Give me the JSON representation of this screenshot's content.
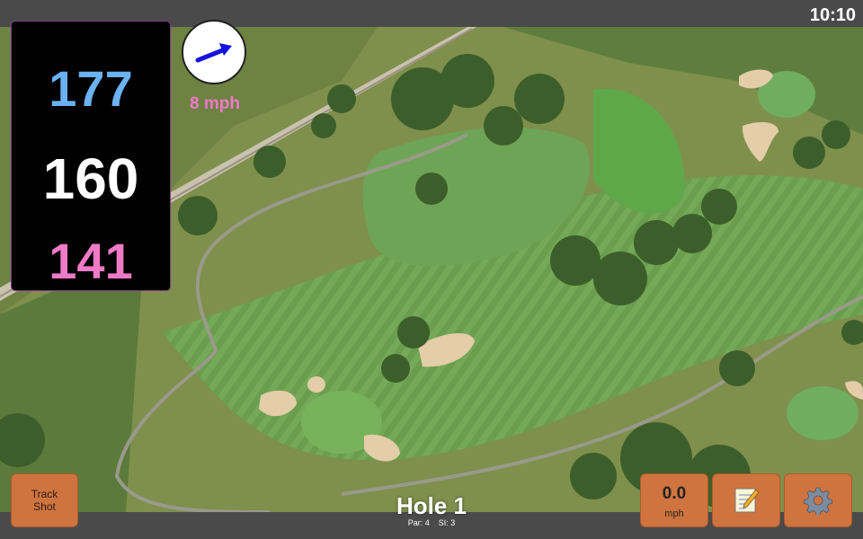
{
  "status": {
    "time": "10:10"
  },
  "distances": {
    "back": "177",
    "middle": "160",
    "front": "141"
  },
  "wind": {
    "speed_label": "8 mph",
    "arrow_icon": "wind-direction-arrow-icon"
  },
  "hole": {
    "title": "Hole 1",
    "par": "Par: 4",
    "stroke_index": "SI: 3"
  },
  "buttons": {
    "track_shot": "Track\nShot",
    "speed_value": "0.0",
    "speed_unit": "mph",
    "notes_icon": "notepad-icon",
    "settings_icon": "gear-icon"
  },
  "colors": {
    "back": "#6ab2f2",
    "middle": "#ffffff",
    "front": "#f07ac8",
    "button": "#d0743f"
  }
}
